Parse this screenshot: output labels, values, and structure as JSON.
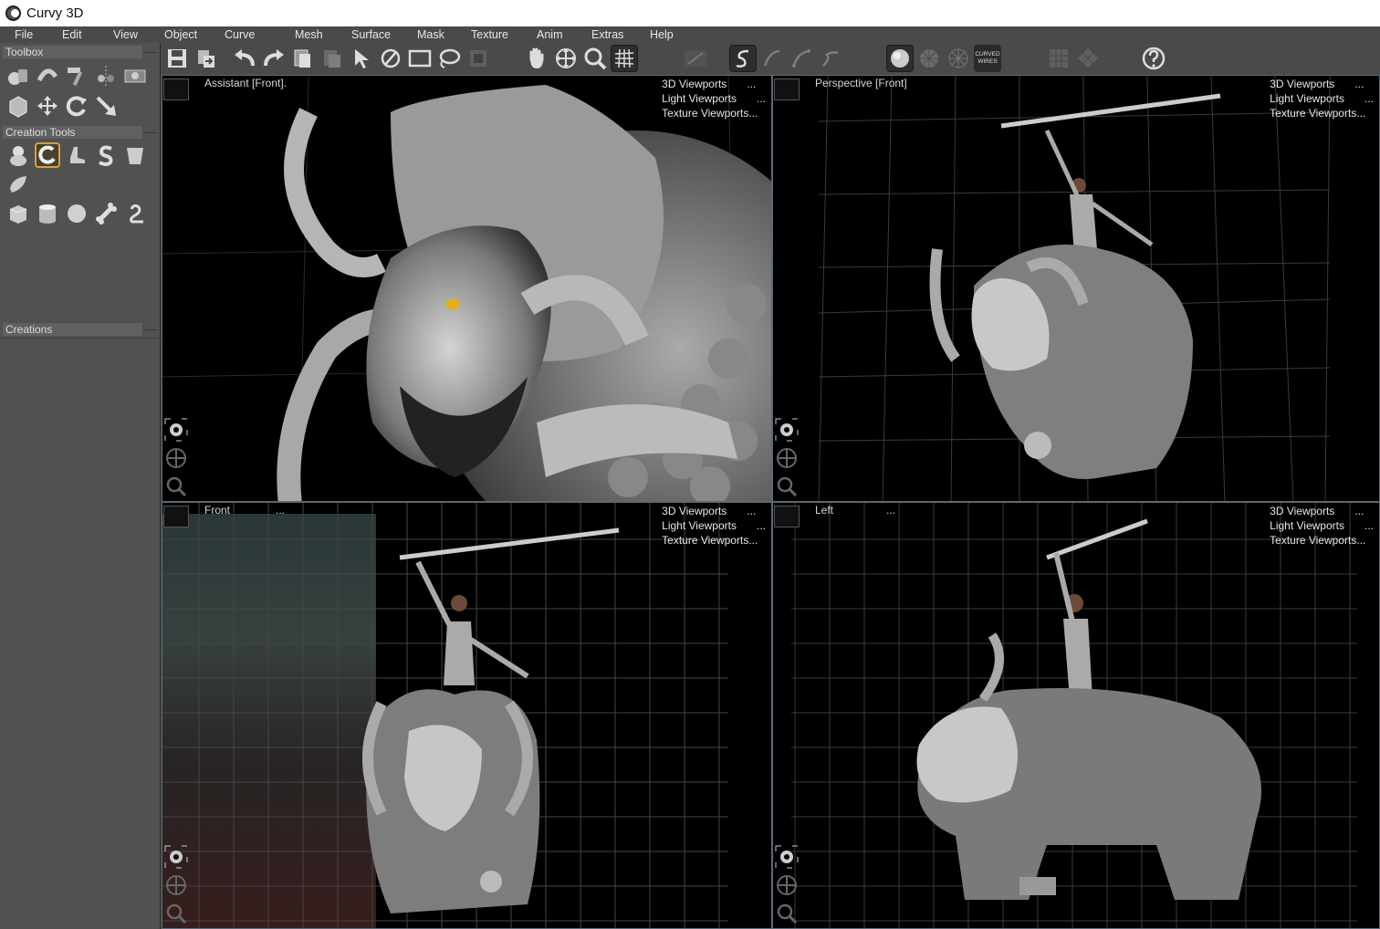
{
  "window": {
    "title": "Curvy 3D"
  },
  "menu": [
    "File",
    "Edit",
    "View",
    "Object",
    "Curve",
    "Mesh",
    "Surface",
    "Mask",
    "Texture",
    "Anim",
    "Extras",
    "Help"
  ],
  "left_panel": {
    "toolbox_label": "Toolbox",
    "creation_tools_label": "Creation Tools",
    "creations_label": "Creations",
    "toolbox_icons": [
      "shapes-icon",
      "bend-icon",
      "hammer-icon",
      "symmetry-icon",
      "camera-icon",
      "cube-frame-icon",
      "move-icon",
      "rotate-icon",
      "scale-icon"
    ],
    "creation_icons": [
      "blob-icon",
      "curl-icon",
      "boot-icon",
      "s-shape-icon",
      "cup-icon",
      "leaf-icon",
      "box-icon",
      "cylinder-icon",
      "sphere-icon",
      "bone-icon",
      "hook-icon"
    ]
  },
  "toolbar": {
    "curved_wires_label": "CURVED\nWIRES"
  },
  "viewports": {
    "top_left": {
      "label": "Assistant [Front].",
      "menu": [
        "3D Viewports",
        "Light Viewports",
        "Texture Viewports..."
      ]
    },
    "top_right": {
      "label": "Perspective [Front]",
      "menu": [
        "3D Viewports",
        "Light Viewports",
        "Texture Viewports..."
      ]
    },
    "bottom_left": {
      "label": "Front",
      "dots": "...",
      "menu": [
        "3D Viewports",
        "Light Viewports",
        "Texture Viewports..."
      ]
    },
    "bottom_right": {
      "label": "Left",
      "dots": "...",
      "menu": [
        "3D Viewports",
        "Light Viewports",
        "Texture Viewports..."
      ]
    },
    "menu_dots": "..."
  },
  "colors": {
    "panel_bg": "#515151",
    "toolbar_bg": "#4a4a4a",
    "viewport_bg": "#000000",
    "accent_active": "#d8a23a"
  }
}
